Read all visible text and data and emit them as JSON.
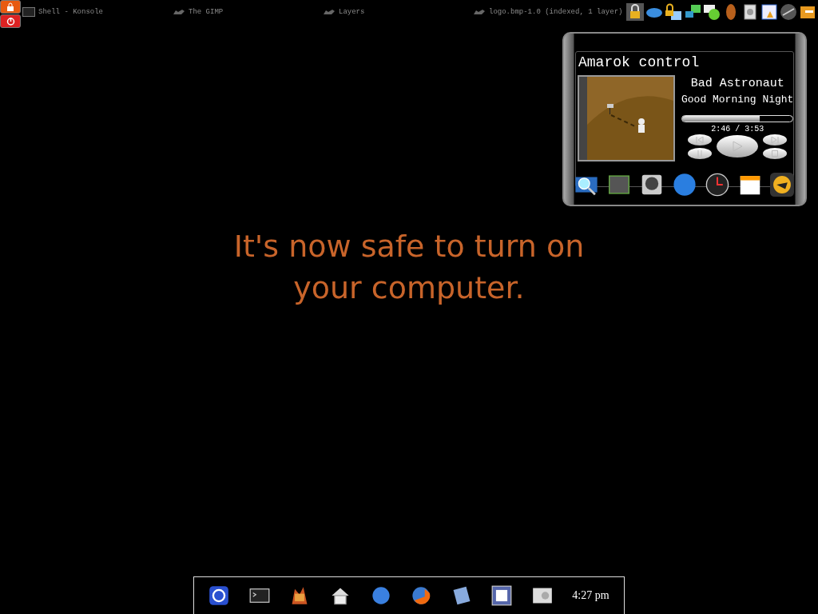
{
  "taskbar": {
    "tasks": [
      {
        "label": "Shell - Konsole",
        "kind": "terminal"
      },
      {
        "label": "The GIMP",
        "kind": "gimp"
      },
      {
        "label": "Layers",
        "kind": "gimp"
      },
      {
        "label": "logo.bmp-1.0 (indexed, 1 layer)",
        "kind": "gimp"
      }
    ]
  },
  "amarok": {
    "title": "Amarok control",
    "artist": "Bad Astronaut",
    "album": "Good Morning Night",
    "progress": {
      "level": 0.7
    },
    "time": "2:46 / 3:53"
  },
  "message": "It's now safe to turn on your computer.",
  "dock": {
    "clock": "4:27 pm"
  }
}
